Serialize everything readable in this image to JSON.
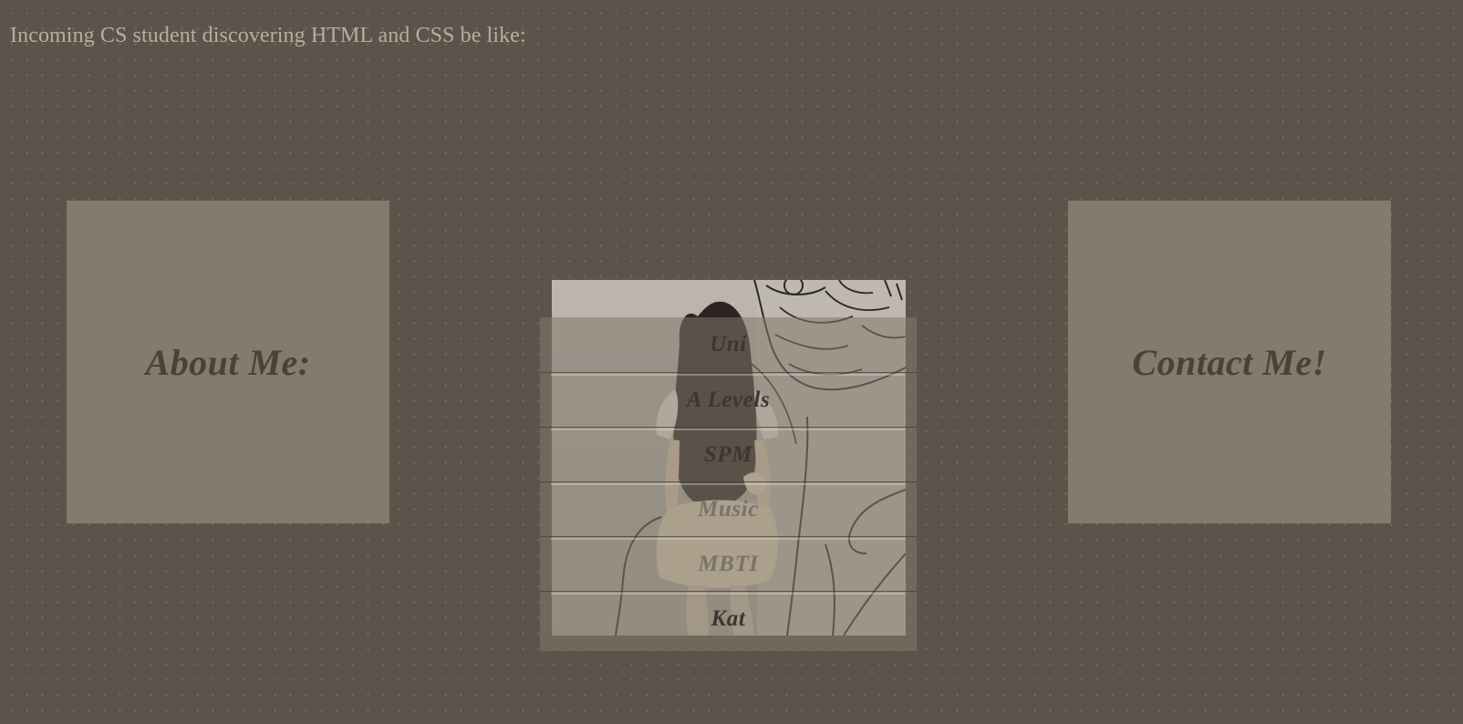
{
  "header": {
    "caption": "Incoming CS student discovering HTML and CSS be like:"
  },
  "cards": {
    "about_label": "About Me:",
    "contact_label": "Contact Me!"
  },
  "menu": {
    "items": [
      {
        "label": "Uni"
      },
      {
        "label": "A Levels"
      },
      {
        "label": "SPM"
      },
      {
        "label": "Music"
      },
      {
        "label": "MBTI"
      },
      {
        "label": "Kat"
      }
    ]
  },
  "photo": {
    "subject": "photo-with-line-drawing"
  },
  "colors": {
    "background": "#5c544a",
    "card": "#847b6d",
    "card_text": "#4a423a",
    "caption_text": "#b7aea0"
  }
}
